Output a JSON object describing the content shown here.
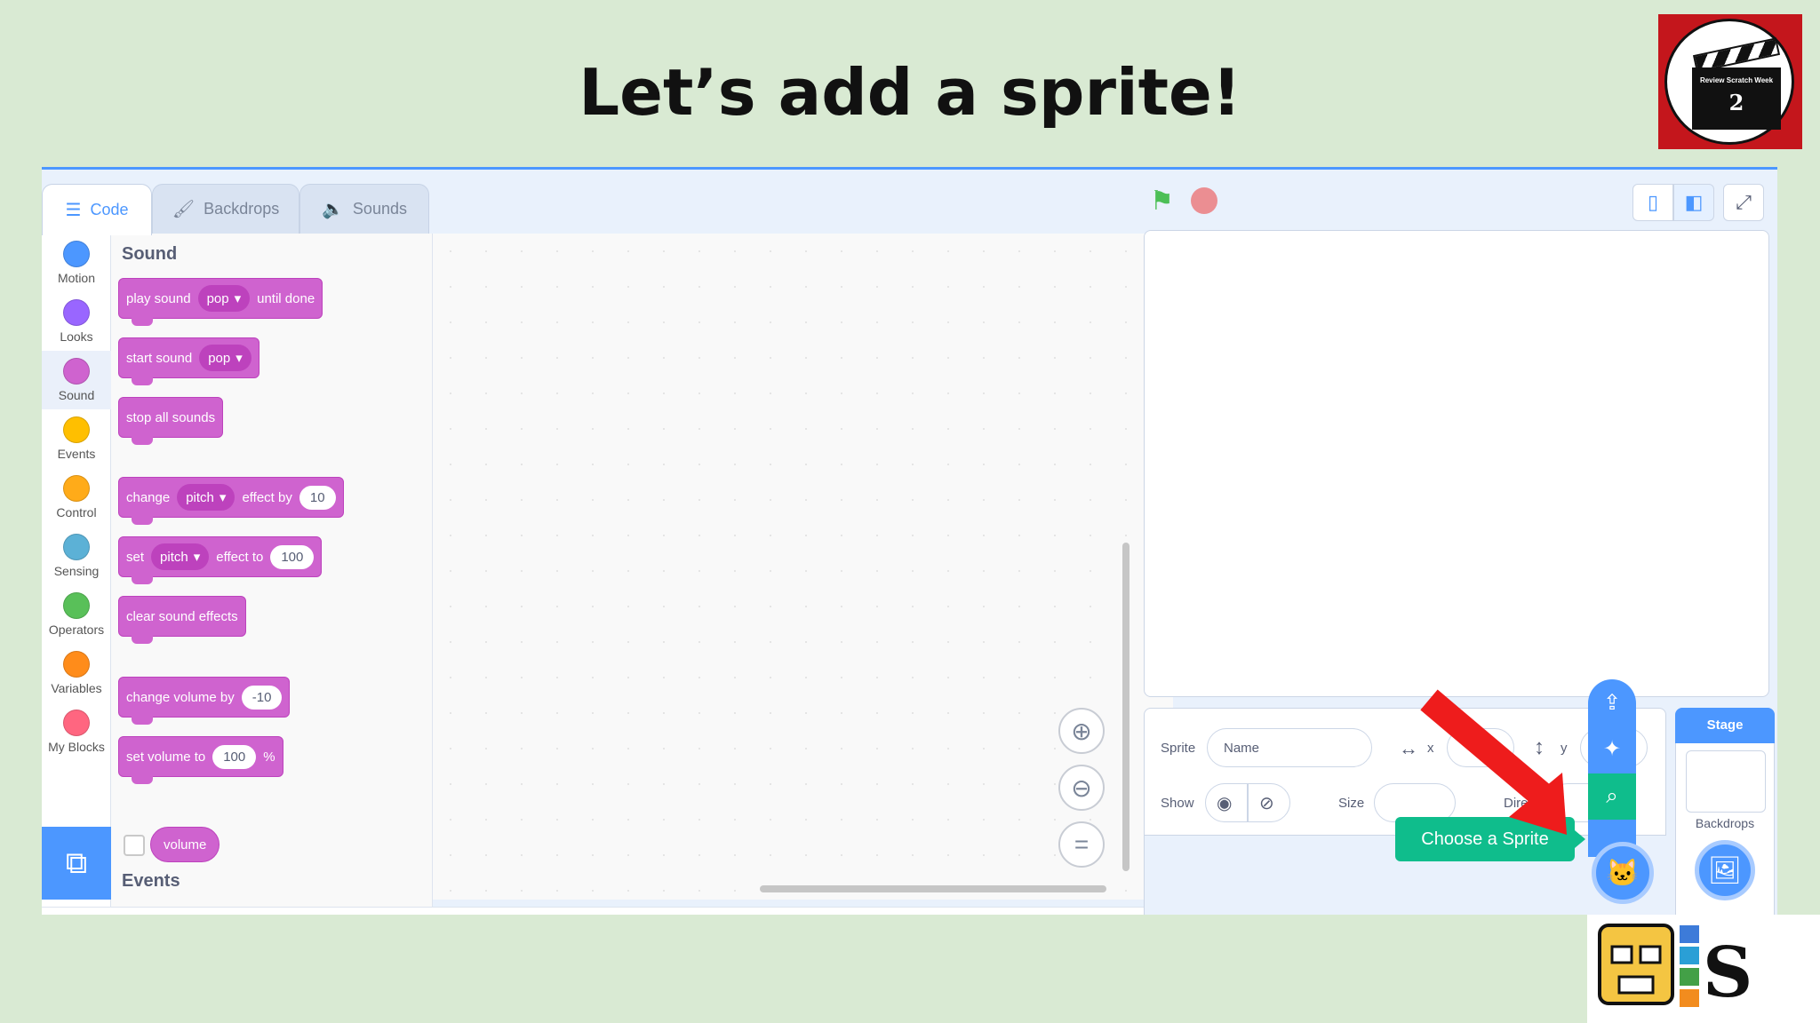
{
  "slide": {
    "title": "Let’s add a sprite!"
  },
  "week_logo": {
    "line1": "Review Scratch Week",
    "number": "2"
  },
  "tabs": [
    {
      "label": "Code",
      "icon": "code-blocks-icon"
    },
    {
      "label": "Backdrops",
      "icon": "brush-icon"
    },
    {
      "label": "Sounds",
      "icon": "speaker-icon"
    }
  ],
  "categories": [
    {
      "label": "Motion",
      "color": "#4c97ff"
    },
    {
      "label": "Looks",
      "color": "#9966ff"
    },
    {
      "label": "Sound",
      "color": "#cf63cf"
    },
    {
      "label": "Events",
      "color": "#ffbf00"
    },
    {
      "label": "Control",
      "color": "#ffab19"
    },
    {
      "label": "Sensing",
      "color": "#5cb1d6"
    },
    {
      "label": "Operators",
      "color": "#59c059"
    },
    {
      "label": "Variables",
      "color": "#ff8c1a"
    },
    {
      "label": "My Blocks",
      "color": "#ff6680"
    }
  ],
  "flyout": {
    "section_sound": "Sound",
    "section_events": "Events",
    "blocks": {
      "play_sound": {
        "a": "play sound",
        "dd": "pop",
        "b": "until done"
      },
      "start_sound": {
        "a": "start sound",
        "dd": "pop"
      },
      "stop_all": {
        "a": "stop all sounds"
      },
      "change_effect": {
        "a": "change",
        "dd": "pitch",
        "b": "effect by",
        "num": "10"
      },
      "set_effect": {
        "a": "set",
        "dd": "pitch",
        "b": "effect to",
        "num": "100"
      },
      "clear_effects": {
        "a": "clear sound effects"
      },
      "change_volume": {
        "a": "change volume by",
        "num": "-10"
      },
      "set_volume": {
        "a": "set volume to",
        "num": "100",
        "b": "%"
      },
      "volume": {
        "a": "volume"
      }
    }
  },
  "sprite_info": {
    "sprite_label": "Sprite",
    "name_placeholder": "Name",
    "x_label": "x",
    "y_label": "y",
    "show_label": "Show",
    "size_label": "Size",
    "direction_label": "Direc"
  },
  "stage_pane": {
    "header": "Stage",
    "backdrops_label": "Backdrops"
  },
  "tooltip": {
    "choose_sprite": "Choose a Sprite"
  },
  "colors": {
    "accent": "#4c97ff",
    "sound": "#cf63cf",
    "success": "#0fbd8c",
    "arrow": "#ee1c1c"
  }
}
